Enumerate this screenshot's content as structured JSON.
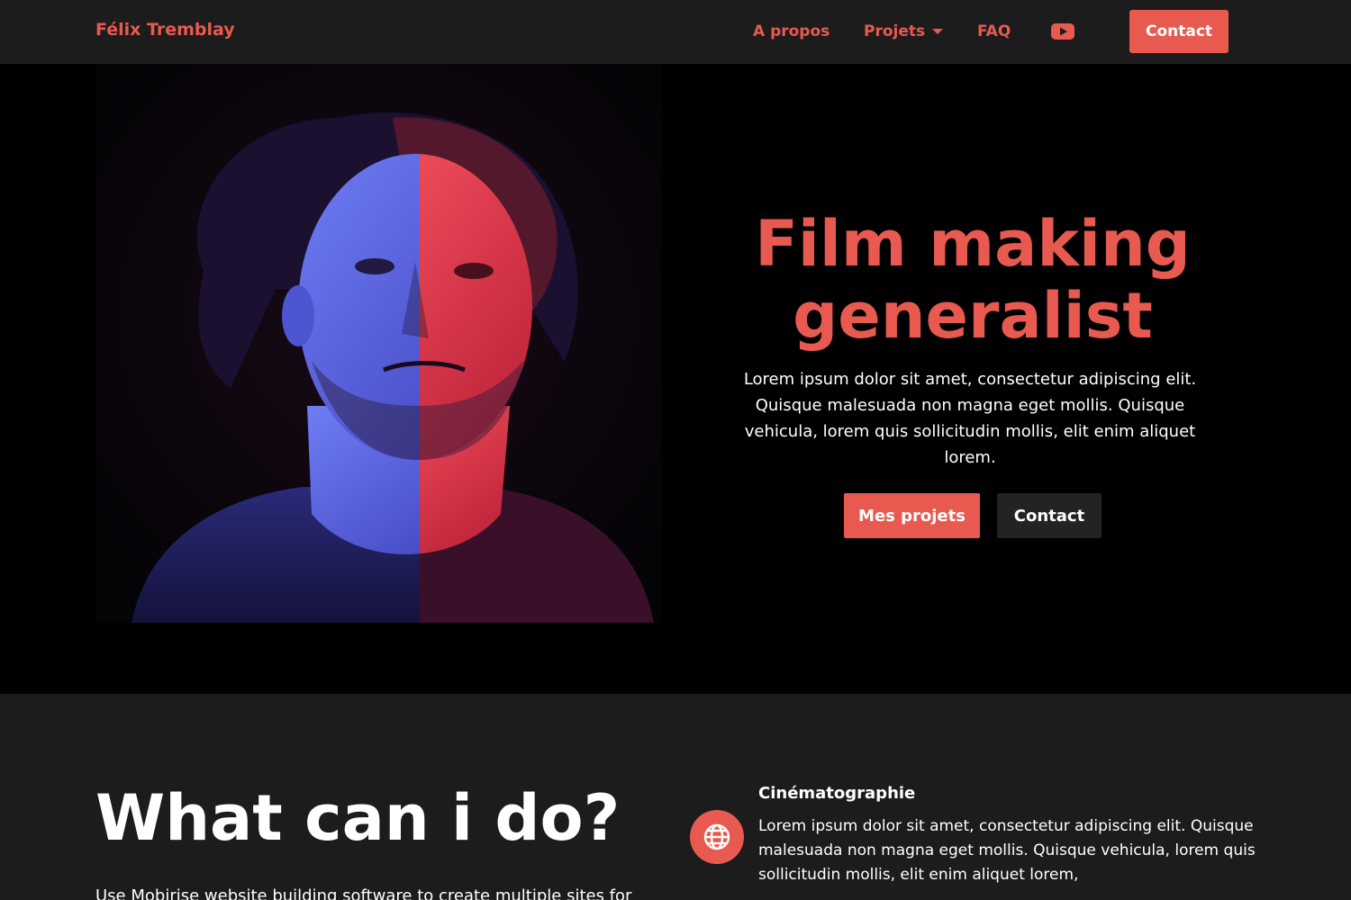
{
  "navbar": {
    "brand": "Félix Tremblay",
    "items": [
      {
        "label": "A propos"
      },
      {
        "label": "Projets"
      },
      {
        "label": "FAQ"
      }
    ],
    "youtube_icon": "youtube-icon",
    "contact_label": "Contact"
  },
  "hero": {
    "title_line1": "Film making",
    "title_line2": "generalist",
    "text": "Lorem ipsum dolor sit amet, consectetur adipiscing elit. Quisque malesuada non magna eget mollis. Quisque vehicula, lorem quis sollicitudin mollis, elit enim aliquet lorem.",
    "primary_button": "Mes projets",
    "secondary_button": "Contact"
  },
  "features": {
    "title": "What can i do?",
    "subtitle": "Use Mobirise website building software to create multiple sites for",
    "items": [
      {
        "icon": "globe-icon",
        "title": "Cinématographie",
        "text": "Lorem ipsum dolor sit amet, consectetur adipiscing elit. Quisque malesuada non magna eget mollis. Quisque vehicula, lorem quis sollicitudin mollis, elit enim aliquet lorem,"
      }
    ]
  },
  "colors": {
    "accent": "#e85a50",
    "navbar_bg": "#1c1c1c",
    "hero_bg": "#000000",
    "dark_button": "#232323"
  }
}
